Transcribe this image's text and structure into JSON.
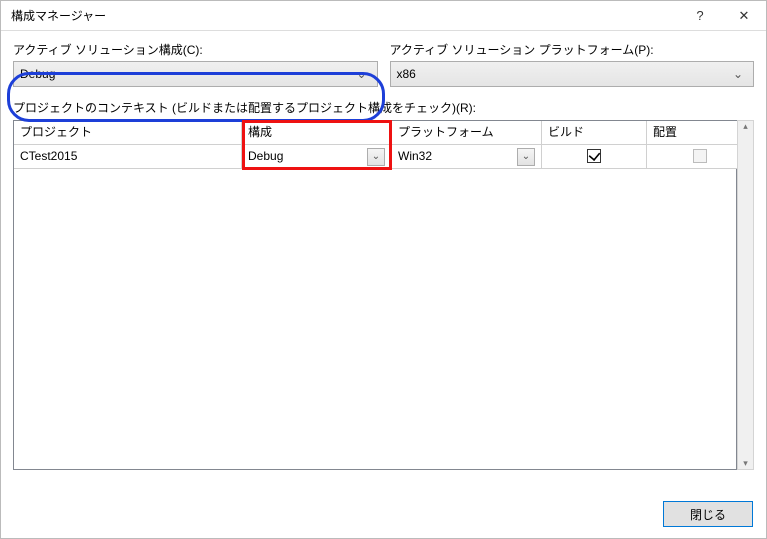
{
  "window": {
    "title": "構成マネージャー"
  },
  "labels": {
    "active_config": "アクティブ ソリューション構成(C):",
    "active_platform": "アクティブ ソリューション プラットフォーム(P):",
    "context": "プロジェクトのコンテキスト (ビルドまたは配置するプロジェクト構成をチェック)(R):"
  },
  "values": {
    "active_config": "Debug",
    "active_platform": "x86"
  },
  "grid": {
    "headers": {
      "project": "プロジェクト",
      "config": "構成",
      "platform": "プラットフォーム",
      "build": "ビルド",
      "deploy": "配置"
    },
    "rows": [
      {
        "project": "CTest2015",
        "config": "Debug",
        "platform": "Win32",
        "build": true,
        "deploy": false,
        "deploy_enabled": false
      }
    ]
  },
  "buttons": {
    "close": "閉じる"
  }
}
